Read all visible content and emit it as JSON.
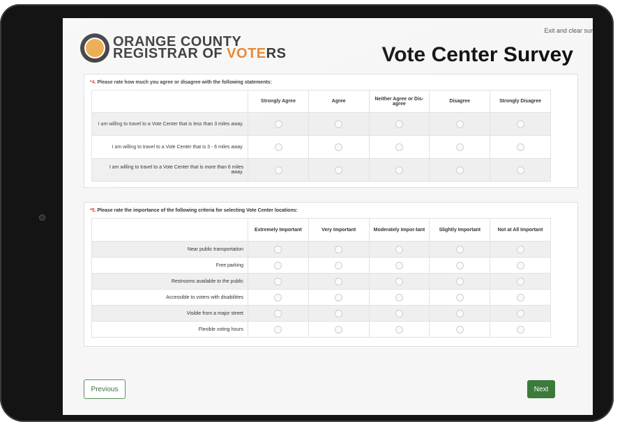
{
  "header": {
    "exit_link": "Exit and clear sur",
    "logo_line1": "ORANGE COUNTY",
    "logo_line2_a": "REGISTRAR OF ",
    "logo_line2_b": "VOTE",
    "logo_line2_c": "RS",
    "title": "Vote Center Survey"
  },
  "q4": {
    "number": "*4.",
    "text": "Please rate how much you agree or disagree with the following statements:",
    "columns": [
      "Strongly Agree",
      "Agree",
      "Neither Agree or Dis-agree",
      "Disagree",
      "Strongly Disagree"
    ],
    "rows": [
      "I am willing to travel to a Vote Center that is less than 3 miles away.",
      "I am willing to travel to a Vote Center that is 3 - 6 miles away.",
      "I am willing to travel to a Vote Center that is more than 6 miles away."
    ]
  },
  "q5": {
    "number": "*5.",
    "text": "Please rate the importance of the following criteria for selecting Vote Center locations:",
    "columns": [
      "Extremely Important",
      "Very Important",
      "Moderately Impor-tant",
      "Slightly Important",
      "Not at All Important"
    ],
    "rows": [
      "Near public transportation",
      "Free parking",
      "Restrooms available to the public",
      "Accessible to voters with disabilities",
      "Visible from a major street",
      "Flexible voting hours"
    ]
  },
  "nav": {
    "previous": "Previous",
    "next": "Next"
  },
  "colors": {
    "accent_green": "#3b7a3b",
    "required_star": "#d63b3b",
    "logo_orange": "#e67e22"
  }
}
